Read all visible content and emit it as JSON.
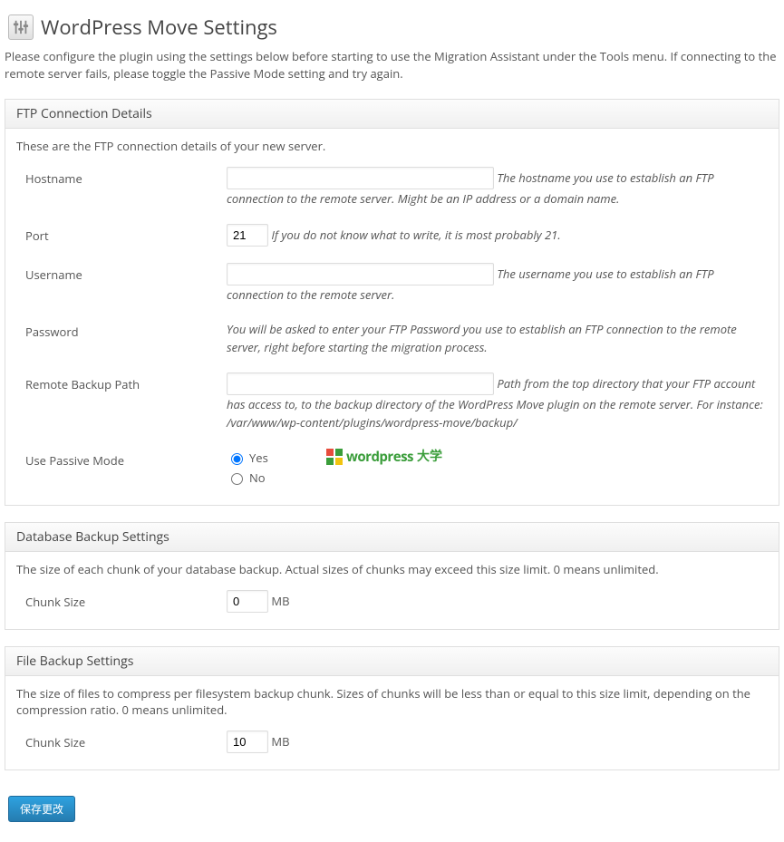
{
  "page": {
    "title": "WordPress Move Settings",
    "intro": "Please configure the plugin using the settings below before starting to use the Migration Assistant under the Tools menu. If connecting to the remote server fails, please toggle the Passive Mode setting and try again."
  },
  "ftp": {
    "heading": "FTP Connection Details",
    "desc": "These are the FTP connection details of your new server.",
    "hostname": {
      "label": "Hostname",
      "value": "",
      "hint": "The hostname you use to establish an FTP connection to the remote server. Might be an IP address or a domain name."
    },
    "port": {
      "label": "Port",
      "value": "21",
      "hint": "If you do not know what to write, it is most probably 21."
    },
    "username": {
      "label": "Username",
      "value": "",
      "hint": "The username you use to establish an FTP connection to the remote server."
    },
    "password": {
      "label": "Password",
      "hint": "You will be asked to enter your FTP Password you use to establish an FTP connection to the remote server, right before starting the migration process."
    },
    "remote_path": {
      "label": "Remote Backup Path",
      "value": "",
      "hint_prefix": "Path from the top directory that your FTP account has access to, to the backup directory of the WordPress Move plugin on the remote server. For instance: ",
      "hint_example": "/var/www/wp-content/plugins/wordpress-move/backup/"
    },
    "passive": {
      "label": "Use Passive Mode",
      "yes": "Yes",
      "no": "No"
    }
  },
  "db": {
    "heading": "Database Backup Settings",
    "desc": "The size of each chunk of your database backup. Actual sizes of chunks may exceed this size limit. 0 means unlimited.",
    "chunk": {
      "label": "Chunk Size",
      "value": "0",
      "unit": "MB"
    }
  },
  "file": {
    "heading": "File Backup Settings",
    "desc": "The size of files to compress per filesystem backup chunk. Sizes of chunks will be less than or equal to this size limit, depending on the compression ratio. 0 means unlimited.",
    "chunk": {
      "label": "Chunk Size",
      "value": "10",
      "unit": "MB"
    }
  },
  "buttons": {
    "save": "保存更改"
  },
  "watermark": {
    "text1": "wordpress",
    "text2": "大学"
  }
}
